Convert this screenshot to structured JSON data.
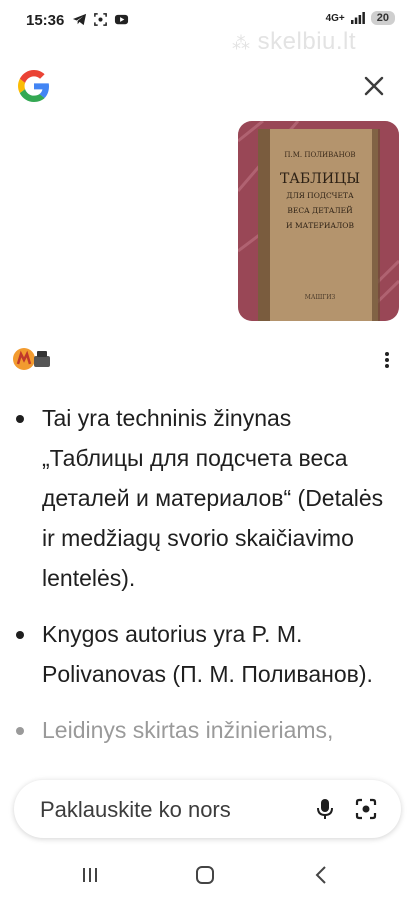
{
  "status": {
    "time": "15:36",
    "network": "4G+",
    "battery": "20"
  },
  "watermark": "skelbiu.lt",
  "header": {
    "close_label": "×"
  },
  "thumbnail": {
    "book_author": "П.М. ПОЛИВАНОВ",
    "book_title_line1": "ТАБЛИЦЫ",
    "book_title_line2": "ДЛЯ ПОДСЧЕТА",
    "book_title_line3": "ВЕСА ДЕТАЛЕЙ",
    "book_title_line4": "И МАТЕРИАЛОВ",
    "book_publisher": "МАШГИЗ"
  },
  "answer": {
    "bullets": [
      "Tai yra techninis žinynas „Таблицы для подсчета веса деталей и материалов“ (Detalės ir medžiagų svorio skaičiavimo lentelės).",
      "Knygos autorius yra P. M. Polivanovas (П. М. Поливанов).",
      "Leidinys skirtas inžinieriams,"
    ]
  },
  "input": {
    "placeholder": "Paklauskite ko nors"
  },
  "icons": {
    "google": "google-logo",
    "close": "close-icon",
    "more": "more-vert-icon",
    "mic": "mic-icon",
    "lens": "lens-icon"
  },
  "colors": {
    "google_blue": "#4285F4",
    "google_red": "#EA4335",
    "google_yellow": "#FBBC05",
    "google_green": "#34A853"
  }
}
